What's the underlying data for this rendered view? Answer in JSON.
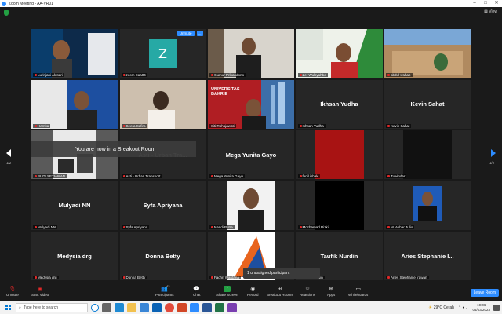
{
  "window": {
    "title": "Zoom Meeting - AA-VR01"
  },
  "view_label": "View",
  "breakout_banner": "You are now in a Breakout Room",
  "unassigned_label": "1 unassigned participant",
  "pages": {
    "left": "1/2",
    "right": "1/2"
  },
  "tiles": [
    {
      "label": "Lurinjani Aktsari",
      "big": "",
      "kind": "video",
      "mic_off": true
    },
    {
      "label": "zoom Eaa04",
      "big": "",
      "kind": "avatar",
      "avatar_letter": "Z",
      "mic_off": true,
      "unmute_label": "Unmute",
      "more_label": "..."
    },
    {
      "label": "Gumur Prihandono",
      "big": "",
      "kind": "video",
      "mic_off": true
    },
    {
      "label": "Zer Wulsyahbo",
      "big": "",
      "kind": "video",
      "mic_off": true
    },
    {
      "label": "abdul wahab",
      "big": "",
      "kind": "video",
      "mic_off": true
    },
    {
      "label": "Hamka",
      "big": "",
      "kind": "video",
      "mic_off": true
    },
    {
      "label": "Seera Safira",
      "big": "",
      "kind": "video",
      "mic_off": true
    },
    {
      "label": "Siti Rohajawati",
      "big": "",
      "kind": "video",
      "mic_off": false,
      "speaking": true,
      "slide_title": "UNIVERSITAS BAKRIE"
    },
    {
      "label": "Ikhsan Yudha",
      "big": "Ikhsan Yudha",
      "kind": "name",
      "mic_off": true
    },
    {
      "label": "Kevin Sahat",
      "big": "Kevin Sahat",
      "kind": "name",
      "mic_off": true
    },
    {
      "label": "BUDI SETIAWAN",
      "big": "",
      "kind": "video",
      "mic_off": true
    },
    {
      "label": "Asti - Urban Transport",
      "big": "Asti - Urban Tra...",
      "kind": "name",
      "mic_off": true
    },
    {
      "label": "Mega Yunita Gayo",
      "big": "Mega Yunita Gayo",
      "kind": "name",
      "mic_off": true
    },
    {
      "label": "fenil ishak",
      "big": "",
      "kind": "video",
      "mic_off": true
    },
    {
      "label": "Tuwindar",
      "big": "",
      "kind": "video",
      "mic_off": true
    },
    {
      "label": "Mulyadi NN",
      "big": "Mulyadi NN",
      "kind": "name",
      "mic_off": true
    },
    {
      "label": "Syfa Apriyana",
      "big": "Syfa Apriyana",
      "kind": "name",
      "mic_off": true
    },
    {
      "label": "Nandi Putra",
      "big": "",
      "kind": "video",
      "mic_off": true
    },
    {
      "label": "Mochamad Rizki",
      "big": "",
      "kind": "video",
      "mic_off": true
    },
    {
      "label": "M. Akbar Julio",
      "big": "",
      "kind": "video",
      "mic_off": true
    },
    {
      "label": "Medysia drg",
      "big": "Medysia drg",
      "kind": "name",
      "mic_off": true
    },
    {
      "label": "Donna Betty",
      "big": "Donna Betty",
      "kind": "name",
      "mic_off": true
    },
    {
      "label": "Fachri Wardana",
      "big": "",
      "kind": "video",
      "mic_off": true
    },
    {
      "label": "Taufik Nurdin",
      "big": "Taufik Nurdin",
      "kind": "name",
      "mic_off": true
    },
    {
      "label": "Aries Stephanie Irawan",
      "big": "Aries Stephanie I...",
      "kind": "name",
      "mic_off": true
    }
  ],
  "toolbar": {
    "unmute": "Unmute",
    "start_video": "Start Video",
    "participants": "Participants",
    "participants_count": "42",
    "chat": "Chat",
    "share_screen": "Share Screen",
    "record": "Record",
    "breakout_rooms": "Breakout Rooms",
    "reactions": "Reactions",
    "apps": "Apps",
    "whiteboards": "Whiteboards",
    "leave": "Leave Room"
  },
  "taskbar": {
    "search_placeholder": "Type here to search",
    "weather": "29°C  Cerah",
    "time": "19:06",
    "date": "04/03/2023"
  },
  "colors": {
    "accent": "#2d8cff",
    "speaking": "#f5d800",
    "share": "#23a043",
    "mic_off": "#e02828"
  }
}
